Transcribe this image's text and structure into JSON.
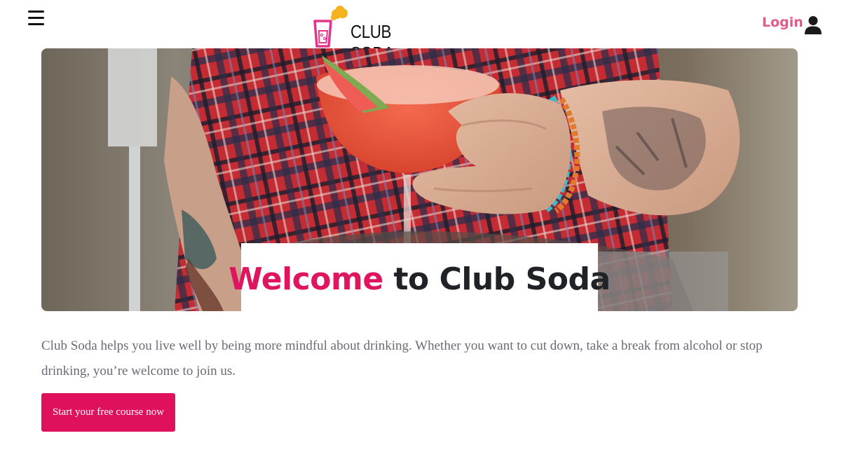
{
  "header": {
    "brand": "CLUB SODA",
    "login_label": "Login",
    "menu_icon": "hamburger-menu-icon",
    "user_icon": "user-icon"
  },
  "hero": {
    "image_subject": "cocktail-glass-photo",
    "welcome_accent": "Welcome",
    "welcome_rest": " to Club Soda"
  },
  "intro": {
    "text": "Club Soda helps you live well by being more mindful about drinking. Whether you want to cut down, take a break from alcohol or stop drinking, you’re welcome to join us."
  },
  "cta": {
    "label": "Start your free course now"
  },
  "colors": {
    "accent": "#e0115c",
    "login": "#e15a8d",
    "title_dark": "#1f2328",
    "body_text": "#6b6b76",
    "logo_bubble": "#f4b21c"
  }
}
